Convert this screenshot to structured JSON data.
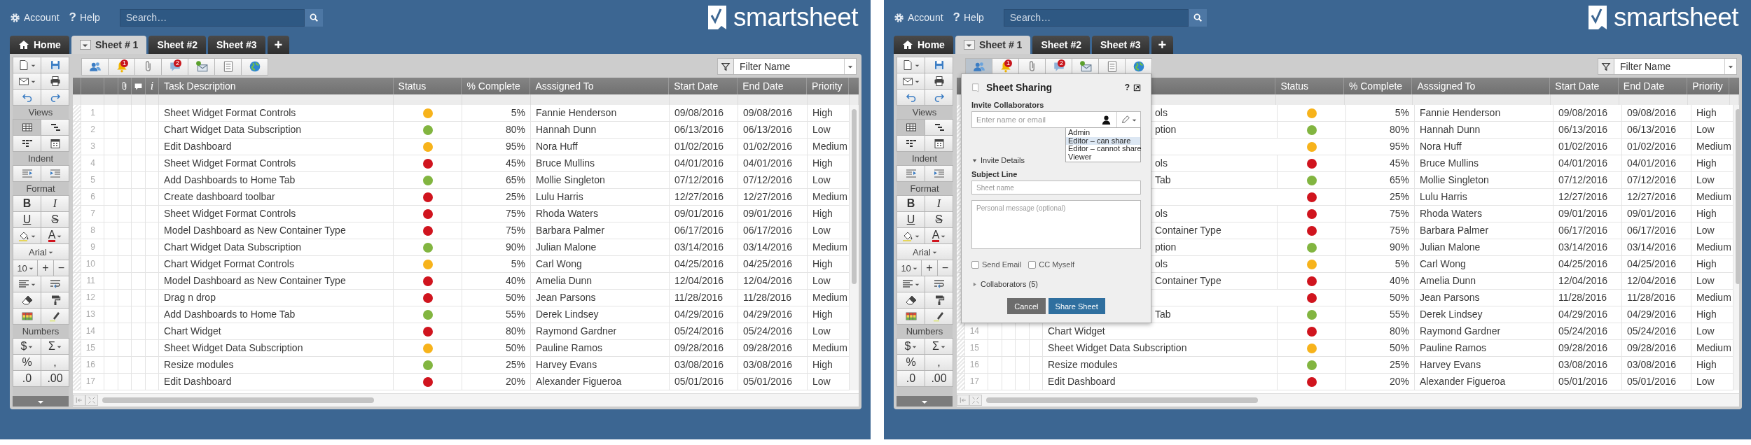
{
  "screens": [
    {
      "top_bar": {
        "account": "Account",
        "help_glyph": "?",
        "help": "Help",
        "search": {
          "placeholder": "Search…"
        },
        "logo": "smartsheet"
      },
      "tabs": [
        {
          "label": "Home",
          "kind": "home",
          "selected": false
        },
        {
          "label": "Sheet # 1",
          "kind": "sheet-menu",
          "selected": true
        },
        {
          "label": "Sheet #2",
          "kind": "sheet",
          "selected": false
        },
        {
          "label": "Sheet #3",
          "kind": "sheet",
          "selected": false
        },
        {
          "label": "+",
          "kind": "add",
          "selected": false
        }
      ],
      "sidebar": [
        {
          "buttons": [
            {
              "kind": "icon",
              "dropdown": true
            },
            {
              "kind": "icon"
            }
          ]
        },
        {
          "buttons": [
            {
              "kind": "icon",
              "dropdown": true
            },
            {
              "kind": "icon"
            }
          ]
        },
        {
          "buttons": [
            {
              "kind": "icon"
            },
            {
              "kind": "icon"
            }
          ]
        },
        {
          "heading": "Views"
        },
        {
          "buttons": [
            {
              "kind": "icon",
              "selected": true
            },
            {
              "kind": "icon",
              "selected": false
            }
          ]
        },
        {
          "buttons": [
            {
              "kind": "icon",
              "selected": false
            },
            {
              "kind": "icon",
              "selected": false
            }
          ]
        },
        {
          "heading": "Indent"
        },
        {
          "buttons": [
            {
              "kind": "icon"
            },
            {
              "kind": "icon"
            }
          ]
        },
        {
          "heading": "Format"
        },
        {
          "buttons": [
            {
              "label": "B",
              "kind": "bold"
            },
            {
              "label": "I",
              "kind": "italic"
            }
          ]
        },
        {
          "buttons": [
            {
              "label": "U",
              "kind": "underline"
            },
            {
              "label": "S",
              "kind": "strike"
            }
          ]
        },
        {
          "buttons": [
            {
              "kind": "icon",
              "dropdown": true
            },
            {
              "label": "A",
              "kind": "font-color",
              "dropdown": true
            }
          ]
        },
        {
          "buttons": [
            {
              "label": "Arial",
              "kind": "select",
              "dropdown": true
            }
          ]
        },
        {
          "buttons": [
            {
              "label": "10",
              "kind": "select",
              "dropdown": true
            },
            {
              "label": "+",
              "kind": "plain"
            },
            {
              "label": "−",
              "kind": "plain"
            }
          ]
        },
        {
          "buttons": [
            {
              "kind": "icon",
              "dropdown": true
            },
            {
              "kind": "icon"
            }
          ]
        },
        {
          "buttons": [
            {
              "kind": "icon"
            },
            {
              "kind": "icon"
            }
          ]
        },
        {
          "buttons": [
            {
              "kind": "icon"
            },
            {
              "kind": "icon"
            }
          ]
        },
        {
          "heading": "Numbers"
        },
        {
          "buttons": [
            {
              "label": "$",
              "kind": "plain",
              "dropdown": true
            },
            {
              "label": "Σ",
              "kind": "plain",
              "dropdown": true
            }
          ]
        },
        {
          "buttons": [
            {
              "label": "%",
              "kind": "plain"
            },
            {
              "label": ",",
              "kind": "plain"
            }
          ]
        },
        {
          "buttons": [
            {
              "label": ".0",
              "kind": "plain"
            },
            {
              "label": ".00",
              "kind": "plain"
            }
          ]
        }
      ],
      "toolbar": [
        {
          "selected": false
        },
        {
          "badge": "1",
          "selected": false
        },
        {
          "selected": false
        },
        {
          "badge": "2",
          "selected": false
        },
        {
          "selected": false
        },
        {
          "selected": false
        },
        {
          "selected": false
        }
      ],
      "filter": {
        "value": "Filter Name"
      },
      "table": {
        "info_header": "i",
        "columns": [
          {
            "label": "Task Description"
          },
          {
            "label": "Status"
          },
          {
            "label": "% Complete"
          },
          {
            "label": "Asssigned To"
          },
          {
            "label": "Start Date"
          },
          {
            "label": "End Date"
          },
          {
            "label": "Priority"
          }
        ],
        "rows": [
          {
            "number": "1",
            "task": "Sheet Widget Format Controls",
            "color": "#f7b31b",
            "complete": "5%",
            "assigned": "Fannie Henderson",
            "start": "09/08/2016",
            "end": "09/08/2016",
            "priority": "High"
          },
          {
            "number": "2",
            "task": "Chart Widget Data Subscription",
            "color": "#82b540",
            "complete": "80%",
            "assigned": "Hannah Dunn",
            "start": "06/13/2016",
            "end": "06/13/2016",
            "priority": "Low"
          },
          {
            "number": "3",
            "task": "Edit Dashboard",
            "color": "#f7b31b",
            "complete": "95%",
            "assigned": "Nora Huff",
            "start": "01/02/2016",
            "end": "01/02/2016",
            "priority": "Medium"
          },
          {
            "number": "4",
            "task": "Sheet Widget Format Controls",
            "color": "#d0141e",
            "complete": "45%",
            "assigned": "Bruce Mullins",
            "start": "04/01/2016",
            "end": "04/01/2016",
            "priority": "High"
          },
          {
            "number": "5",
            "task": "Add Dashboards to Home Tab",
            "color": "#82b540",
            "complete": "65%",
            "assigned": "Mollie Singleton",
            "start": "07/12/2016",
            "end": "07/12/2016",
            "priority": "Low"
          },
          {
            "number": "6",
            "task": "Create dashboard toolbar",
            "color": "#d0141e",
            "complete": "25%",
            "assigned": "Lulu Harris",
            "start": "12/27/2016",
            "end": "12/27/2016",
            "priority": "Medium"
          },
          {
            "number": "7",
            "task": "Sheet Widget Format Controls",
            "color": "#d0141e",
            "complete": "75%",
            "assigned": "Rhoda Waters",
            "start": "09/01/2016",
            "end": "09/01/2016",
            "priority": "High"
          },
          {
            "number": "8",
            "task": "Model Dashboard as New Container Type",
            "color": "#d0141e",
            "complete": "75%",
            "assigned": "Barbara Palmer",
            "start": "06/17/2016",
            "end": "06/17/2016",
            "priority": "Low"
          },
          {
            "number": "9",
            "task": "Chart Widget Data Subscription",
            "color": "#82b540",
            "complete": "90%",
            "assigned": "Julian Malone",
            "start": "03/14/2016",
            "end": "03/14/2016",
            "priority": "Medium"
          },
          {
            "number": "10",
            "task": "Chart Widget Format Controls",
            "color": "#f7b31b",
            "complete": "5%",
            "assigned": "Carl Wong",
            "start": "04/25/2016",
            "end": "04/25/2016",
            "priority": "High"
          },
          {
            "number": "11",
            "task": "Model Dashboard as New Container Type",
            "color": "#d0141e",
            "complete": "40%",
            "assigned": "Amelia Dunn",
            "start": "12/04/2016",
            "end": "12/04/2016",
            "priority": "Low"
          },
          {
            "number": "12",
            "task": "Drag n drop",
            "color": "#d0141e",
            "complete": "50%",
            "assigned": "Jean Parsons",
            "start": "11/28/2016",
            "end": "11/28/2016",
            "priority": "Medium"
          },
          {
            "number": "13",
            "task": "Add Dashboards to Home Tab",
            "color": "#82b540",
            "complete": "55%",
            "assigned": "Derek Lindsey",
            "start": "04/29/2016",
            "end": "04/29/2016",
            "priority": "High"
          },
          {
            "number": "14",
            "task": "Chart Widget",
            "color": "#d0141e",
            "complete": "80%",
            "assigned": "Raymond Gardner",
            "start": "05/24/2016",
            "end": "05/24/2016",
            "priority": "Low"
          },
          {
            "number": "15",
            "task": "Sheet Widget Data Subscription",
            "color": "#f7b31b",
            "complete": "50%",
            "assigned": "Pauline Ramos",
            "start": "09/28/2016",
            "end": "09/28/2016",
            "priority": "Medium"
          },
          {
            "number": "16",
            "task": "Resize modules",
            "color": "#82b540",
            "complete": "25%",
            "assigned": "Harvey Evans",
            "start": "03/08/2016",
            "end": "03/08/2016",
            "priority": "High"
          },
          {
            "number": "17",
            "task": "Edit Dashboard",
            "color": "#d0141e",
            "complete": "20%",
            "assigned": "Alexander Figueroa",
            "start": "05/01/2016",
            "end": "05/01/2016",
            "priority": "Low"
          }
        ]
      }
    },
    {
      "top_bar": {
        "account": "Account",
        "help_glyph": "?",
        "help": "Help",
        "search": {
          "placeholder": "Search…"
        },
        "logo": "smartsheet"
      },
      "tabs": [
        {
          "label": "Home",
          "kind": "home",
          "selected": false
        },
        {
          "label": "Sheet # 1",
          "kind": "sheet-menu",
          "selected": true
        },
        {
          "label": "Sheet #2",
          "kind": "sheet",
          "selected": false
        },
        {
          "label": "Sheet #3",
          "kind": "sheet",
          "selected": false
        },
        {
          "label": "+",
          "kind": "add",
          "selected": false
        }
      ],
      "sidebar": [
        {
          "buttons": [
            {
              "kind": "icon",
              "dropdown": true
            },
            {
              "kind": "icon"
            }
          ]
        },
        {
          "buttons": [
            {
              "kind": "icon",
              "dropdown": true
            },
            {
              "kind": "icon"
            }
          ]
        },
        {
          "buttons": [
            {
              "kind": "icon"
            },
            {
              "kind": "icon"
            }
          ]
        },
        {
          "heading": "Views"
        },
        {
          "buttons": [
            {
              "kind": "icon",
              "selected": true
            },
            {
              "kind": "icon",
              "selected": false
            }
          ]
        },
        {
          "buttons": [
            {
              "kind": "icon",
              "selected": false
            },
            {
              "kind": "icon",
              "selected": false
            }
          ]
        },
        {
          "heading": "Indent"
        },
        {
          "buttons": [
            {
              "kind": "icon"
            },
            {
              "kind": "icon"
            }
          ]
        },
        {
          "heading": "Format"
        },
        {
          "buttons": [
            {
              "label": "B",
              "kind": "bold"
            },
            {
              "label": "I",
              "kind": "italic"
            }
          ]
        },
        {
          "buttons": [
            {
              "label": "U",
              "kind": "underline"
            },
            {
              "label": "S",
              "kind": "strike"
            }
          ]
        },
        {
          "buttons": [
            {
              "kind": "icon",
              "dropdown": true
            },
            {
              "label": "A",
              "kind": "font-color",
              "dropdown": true
            }
          ]
        },
        {
          "buttons": [
            {
              "label": "Arial",
              "kind": "select",
              "dropdown": true
            }
          ]
        },
        {
          "buttons": [
            {
              "label": "10",
              "kind": "select",
              "dropdown": true
            },
            {
              "label": "+",
              "kind": "plain"
            },
            {
              "label": "−",
              "kind": "plain"
            }
          ]
        },
        {
          "buttons": [
            {
              "kind": "icon",
              "dropdown": true
            },
            {
              "kind": "icon"
            }
          ]
        },
        {
          "buttons": [
            {
              "kind": "icon"
            },
            {
              "kind": "icon"
            }
          ]
        },
        {
          "buttons": [
            {
              "kind": "icon"
            },
            {
              "kind": "icon"
            }
          ]
        },
        {
          "heading": "Numbers"
        },
        {
          "buttons": [
            {
              "label": "$",
              "kind": "plain",
              "dropdown": true
            },
            {
              "label": "Σ",
              "kind": "plain",
              "dropdown": true
            }
          ]
        },
        {
          "buttons": [
            {
              "label": "%",
              "kind": "plain"
            },
            {
              "label": ",",
              "kind": "plain"
            }
          ]
        },
        {
          "buttons": [
            {
              "label": ".0",
              "kind": "plain"
            },
            {
              "label": ".00",
              "kind": "plain"
            }
          ]
        }
      ],
      "toolbar": [
        {
          "selected": true
        },
        {
          "badge": "1",
          "selected": false
        },
        {
          "selected": false
        },
        {
          "badge": "2",
          "selected": false
        },
        {
          "selected": false
        },
        {
          "selected": false
        },
        {
          "selected": false
        }
      ],
      "filter": {
        "value": "Filter Name"
      },
      "table": {
        "columns": [
          {
            "label": "Status"
          },
          {
            "label": "% Complete"
          },
          {
            "label": "Asssigned To"
          },
          {
            "label": "Start Date"
          },
          {
            "label": "End Date"
          },
          {
            "label": "Priority"
          }
        ],
        "rows": [
          {
            "task": "ols",
            "color": "#f7b31b",
            "complete": "5%",
            "assigned": "Fannie Henderson",
            "start": "09/08/2016",
            "end": "09/08/2016",
            "priority": "High"
          },
          {
            "task": "ption",
            "color": "#82b540",
            "complete": "80%",
            "assigned": "Hannah Dunn",
            "start": "06/13/2016",
            "end": "06/13/2016",
            "priority": "Low"
          },
          {
            "color": "#f7b31b",
            "complete": "95%",
            "assigned": "Nora Huff",
            "start": "01/02/2016",
            "end": "01/02/2016",
            "priority": "Medium"
          },
          {
            "task": "ols",
            "color": "#d0141e",
            "complete": "45%",
            "assigned": "Bruce Mullins",
            "start": "04/01/2016",
            "end": "04/01/2016",
            "priority": "High"
          },
          {
            "task": "Tab",
            "color": "#82b540",
            "complete": "65%",
            "assigned": "Mollie Singleton",
            "start": "07/12/2016",
            "end": "07/12/2016",
            "priority": "Low"
          },
          {
            "color": "#d0141e",
            "complete": "25%",
            "assigned": "Lulu Harris",
            "start": "12/27/2016",
            "end": "12/27/2016",
            "priority": "Medium"
          },
          {
            "task": "ols",
            "color": "#d0141e",
            "complete": "75%",
            "assigned": "Rhoda Waters",
            "start": "09/01/2016",
            "end": "09/01/2016",
            "priority": "High"
          },
          {
            "task": "Container Type",
            "color": "#d0141e",
            "complete": "75%",
            "assigned": "Barbara Palmer",
            "start": "06/17/2016",
            "end": "06/17/2016",
            "priority": "Low"
          },
          {
            "task": "ption",
            "color": "#82b540",
            "complete": "90%",
            "assigned": "Julian Malone",
            "start": "03/14/2016",
            "end": "03/14/2016",
            "priority": "Medium"
          },
          {
            "task": "ols",
            "color": "#f7b31b",
            "complete": "5%",
            "assigned": "Carl Wong",
            "start": "04/25/2016",
            "end": "04/25/2016",
            "priority": "High"
          },
          {
            "task": "Container Type",
            "color": "#d0141e",
            "complete": "40%",
            "assigned": "Amelia Dunn",
            "start": "12/04/2016",
            "end": "12/04/2016",
            "priority": "Low"
          },
          {
            "color": "#d0141e",
            "complete": "50%",
            "assigned": "Jean Parsons",
            "start": "11/28/2016",
            "end": "11/28/2016",
            "priority": "Medium"
          },
          {
            "task": "Tab",
            "color": "#82b540",
            "complete": "55%",
            "assigned": "Derek Lindsey",
            "start": "04/29/2016",
            "end": "04/29/2016",
            "priority": "High"
          },
          {
            "number": "14",
            "task": "Chart Widget",
            "color": "#d0141e",
            "complete": "80%",
            "assigned": "Raymond Gardner",
            "start": "05/24/2016",
            "end": "05/24/2016",
            "priority": "Low"
          },
          {
            "number": "15",
            "task": "Sheet Widget Data Subscription",
            "color": "#f7b31b",
            "complete": "50%",
            "assigned": "Pauline Ramos",
            "start": "09/28/2016",
            "end": "09/28/2016",
            "priority": "Medium"
          },
          {
            "number": "16",
            "task": "Resize modules",
            "color": "#82b540",
            "complete": "25%",
            "assigned": "Harvey Evans",
            "start": "03/08/2016",
            "end": "03/08/2016",
            "priority": "High"
          },
          {
            "number": "17",
            "task": "Edit Dashboard",
            "color": "#d0141e",
            "complete": "20%",
            "assigned": "Alexander Figueroa",
            "start": "05/01/2016",
            "end": "05/01/2016",
            "priority": "Low"
          }
        ]
      },
      "dialog": {
        "title": "Sheet Sharing",
        "help": "?",
        "invite_label": "Invite Collaborators",
        "invite_field": {
          "placeholder": "Enter name or email"
        },
        "permissions": [
          {
            "label": "Admin",
            "selected": false
          },
          {
            "label": "Editor – can share",
            "selected": true
          },
          {
            "label": "Editor – cannot share",
            "selected": false
          },
          {
            "label": "Viewer",
            "selected": false
          }
        ],
        "details": {
          "label": "Invite Details",
          "expanded": true
        },
        "subject_label": "Subject Line",
        "subject_field": {
          "placeholder": "Sheet name"
        },
        "message_field": {
          "placeholder": "Personal message (optional)"
        },
        "checkboxes": [
          {
            "label": "Send Email",
            "checked": false
          },
          {
            "label": "CC Myself",
            "checked": false
          }
        ],
        "collaborators": {
          "label": "Collaborators (5)",
          "expanded": false
        },
        "buttons": [
          {
            "label": "Cancel",
            "kind": "secondary"
          },
          {
            "label": "Share Sheet",
            "kind": "primary"
          }
        ]
      }
    }
  ]
}
